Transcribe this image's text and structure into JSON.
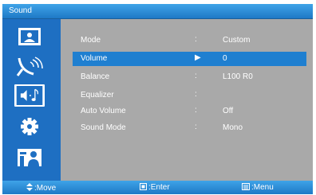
{
  "window": {
    "title": "Sound"
  },
  "sidebar": {
    "items": [
      {
        "name": "picture",
        "icon": "picture-icon",
        "active": false
      },
      {
        "name": "channel",
        "icon": "satellite-dish-icon",
        "active": false
      },
      {
        "name": "sound",
        "icon": "speaker-note-icon",
        "active": true
      },
      {
        "name": "setup",
        "icon": "gear-icon",
        "active": false
      },
      {
        "name": "input",
        "icon": "person-box-icon",
        "active": false
      }
    ]
  },
  "menu": {
    "rows": [
      {
        "label": "Mode",
        "separator": ":",
        "value": "Custom",
        "selected": false
      },
      {
        "label": "Volume",
        "separator": "▶",
        "value": "0",
        "selected": true
      },
      {
        "label": "Balance",
        "separator": ":",
        "value": "L100  R0",
        "selected": false
      },
      {
        "label": "Equalizer",
        "separator": ":",
        "value": "",
        "selected": false
      },
      {
        "label": "Auto Volume",
        "separator": ":",
        "value": "Off",
        "selected": false
      },
      {
        "label": "Sound Mode",
        "separator": ":",
        "value": "Mono",
        "selected": false
      }
    ]
  },
  "footer": {
    "move": {
      "icon": "up-down-arrows-icon",
      "label": ":Move"
    },
    "enter": {
      "icon": "enter-button-icon",
      "label": ":Enter"
    },
    "menu": {
      "icon": "menu-button-icon",
      "label": ":Menu"
    }
  },
  "colors": {
    "accent": "#1f7fd0",
    "sidebar": "#1e6fc2",
    "panel": "#a9a9a9"
  }
}
